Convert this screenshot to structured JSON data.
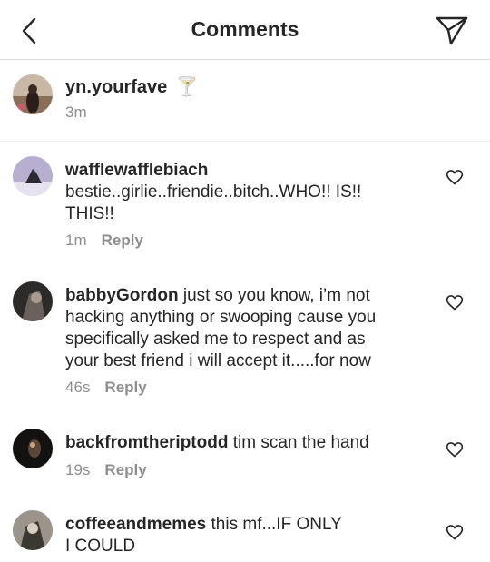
{
  "header": {
    "title": "Comments",
    "back_icon": "chevron-left-icon",
    "share_icon": "paper-plane-icon"
  },
  "caption": {
    "username": "yn.yourfave",
    "emoji": "🍸",
    "time": "3m"
  },
  "comments": [
    {
      "username": "wafflewafflebiach",
      "lines": [
        "bestie..girlie..friendie..bitch..WHO!! IS!!",
        "THIS!!"
      ],
      "time": "1m",
      "reply": "Reply"
    },
    {
      "username": "babbyGordon",
      "lines": [
        "just so you know, i’m not",
        "hacking anything or swooping cause you",
        "specifically asked me to respect and as",
        "your best friend i will accept it.....for now"
      ],
      "time": "46s",
      "reply": "Reply"
    },
    {
      "username": "backfromtheriptodd",
      "lines": [
        "tim scan the hand"
      ],
      "time": "19s",
      "reply": "Reply"
    },
    {
      "username": "coffeeandmemes",
      "lines": [
        "this mf...IF ONLY",
        "I COULD"
      ],
      "time": "",
      "reply": ""
    }
  ],
  "colors": {
    "text": "#262626",
    "meta": "#8e8e8e",
    "divider": "#dbdbdb"
  }
}
